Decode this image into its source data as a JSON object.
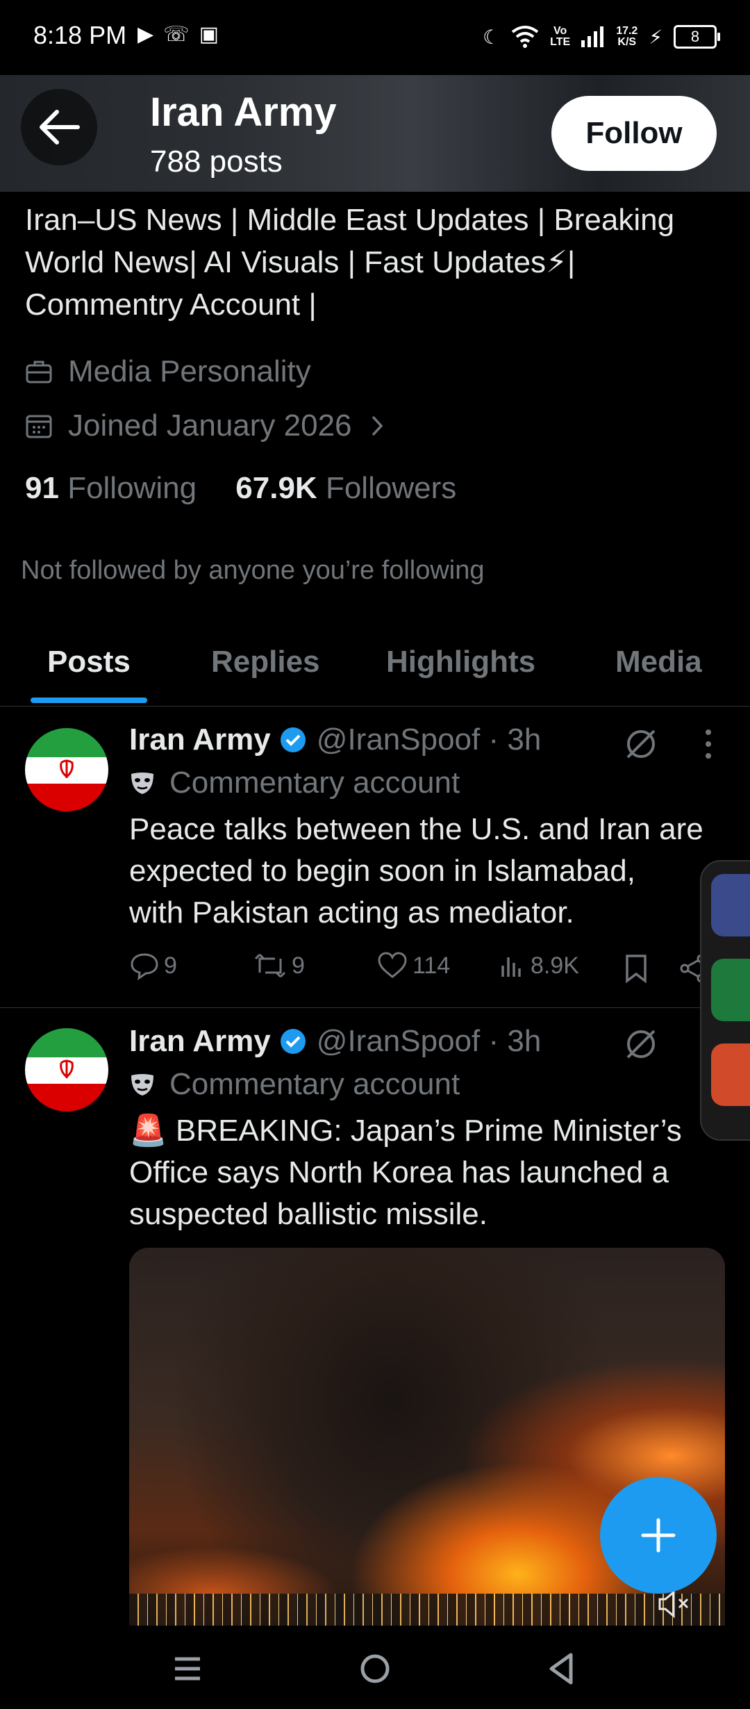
{
  "status_bar": {
    "time": "8:18 PM",
    "network_top": "Vo",
    "network_bottom": "LTE",
    "speed_top": "17.2",
    "speed_bottom": "K/S",
    "battery": "8"
  },
  "header": {
    "name": "Iran Army",
    "posts_count": "788 posts",
    "follow_label": "Follow"
  },
  "profile": {
    "bio_lines": [
      "Iran–US News | Middle East Updates | Breaking",
      "World News| AI Visuals | Fast Updates⚡|",
      "Commentry Account |"
    ],
    "category": "Media Personality",
    "joined": "Joined January 2026",
    "following_count": "91",
    "following_label": "Following",
    "followers_count": "67.9K",
    "followers_label": "Followers",
    "not_followed": "Not followed by anyone you’re following"
  },
  "tabs": [
    "Posts",
    "Replies",
    "Highlights",
    "Media"
  ],
  "posts": [
    {
      "name": "Iran Army",
      "handle": "@IranSpoof · 3h",
      "label": "Commentary account",
      "text_lines": [
        "Peace talks between the U.S. and Iran are",
        "expected to begin soon in Islamabad,",
        "with Pakistan acting as mediator."
      ],
      "replies": "9",
      "reposts": "9",
      "likes": "114",
      "views": "8.9K"
    },
    {
      "name": "Iran Army",
      "handle": "@IranSpoof · 3h",
      "label": "Commentary account",
      "text_lines": [
        "🚨 BREAKING: Japan’s Prime Minister’s",
        "Office says North Korea has launched a",
        "suspected ballistic missile."
      ]
    }
  ],
  "colors": {
    "accent": "#1d9bf0",
    "secondary_text": "#71767b",
    "background": "#000000"
  }
}
